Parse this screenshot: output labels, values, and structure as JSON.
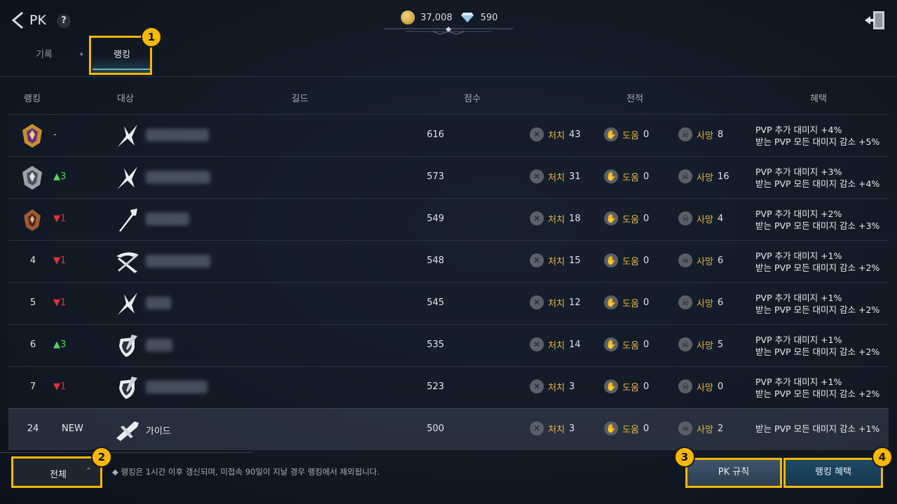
{
  "header": {
    "title": "PK",
    "help_label": "?",
    "gold": "37,008",
    "diamond": "590"
  },
  "tabs": {
    "record": "기록",
    "ranking": "랭킹",
    "separator": "✦"
  },
  "callouts": [
    "1",
    "2",
    "3",
    "4"
  ],
  "table": {
    "headers": {
      "rank": "랭킹",
      "target": "대상",
      "guild": "길드",
      "score": "점수",
      "record": "전적",
      "benefit": "혜택"
    },
    "labels": {
      "kill": "처치",
      "assist": "도움",
      "death": "사망"
    },
    "rows": [
      {
        "rank": "",
        "change": "-",
        "name": "",
        "score": "616",
        "kill": "43",
        "assist": "0",
        "death": "8",
        "benefit1": "PVP 추가 대미지 +4%",
        "benefit2": "받는 PVP 모든 대미지 감소 +5%"
      },
      {
        "rank": "",
        "change": "▲3",
        "name": "",
        "score": "573",
        "kill": "31",
        "assist": "0",
        "death": "16",
        "benefit1": "PVP 추가 대미지 +3%",
        "benefit2": "받는 PVP 모든 대미지 감소 +4%"
      },
      {
        "rank": "",
        "change": "▼1",
        "name": "",
        "score": "549",
        "kill": "18",
        "assist": "0",
        "death": "4",
        "benefit1": "PVP 추가 대미지 +2%",
        "benefit2": "받는 PVP 모든 대미지 감소 +3%"
      },
      {
        "rank": "4",
        "change": "▼1",
        "name": "",
        "score": "548",
        "kill": "15",
        "assist": "0",
        "death": "6",
        "benefit1": "PVP 추가 대미지 +1%",
        "benefit2": "받는 PVP 모든 대미지 감소 +2%"
      },
      {
        "rank": "5",
        "change": "▼1",
        "name": "",
        "score": "545",
        "kill": "12",
        "assist": "0",
        "death": "6",
        "benefit1": "PVP 추가 대미지 +1%",
        "benefit2": "받는 PVP 모든 대미지 감소 +2%"
      },
      {
        "rank": "6",
        "change": "▲3",
        "name": "",
        "score": "535",
        "kill": "14",
        "assist": "0",
        "death": "5",
        "benefit1": "PVP 추가 대미지 +1%",
        "benefit2": "받는 PVP 모든 대미지 감소 +2%"
      },
      {
        "rank": "7",
        "change": "▼1",
        "name": "",
        "score": "523",
        "kill": "3",
        "assist": "0",
        "death": "0",
        "benefit1": "PVP 추가 대미지 +1%",
        "benefit2": "받는 PVP 모든 대미지 감소 +2%"
      },
      {
        "rank": "24",
        "change": "NEW",
        "name": "가이드",
        "score": "500",
        "kill": "3",
        "assist": "0",
        "death": "2",
        "benefit1": "받는 PVP 모든 대미지 감소 +1%",
        "benefit2": ""
      }
    ]
  },
  "footer": {
    "filter_label": "전체",
    "note": "◆ 랭킹은 1시간 이후 갱신되며, 미접속 90일이 지날 경우 랭킹에서 제외됩니다.",
    "rules_button": "PK 규칙",
    "benefit_button": "랭킹 혜택"
  },
  "colors": {
    "accent_highlight": "#f5b800",
    "up": "#53d35b",
    "down": "#e2323a",
    "stat_key": "#e3b44a"
  }
}
